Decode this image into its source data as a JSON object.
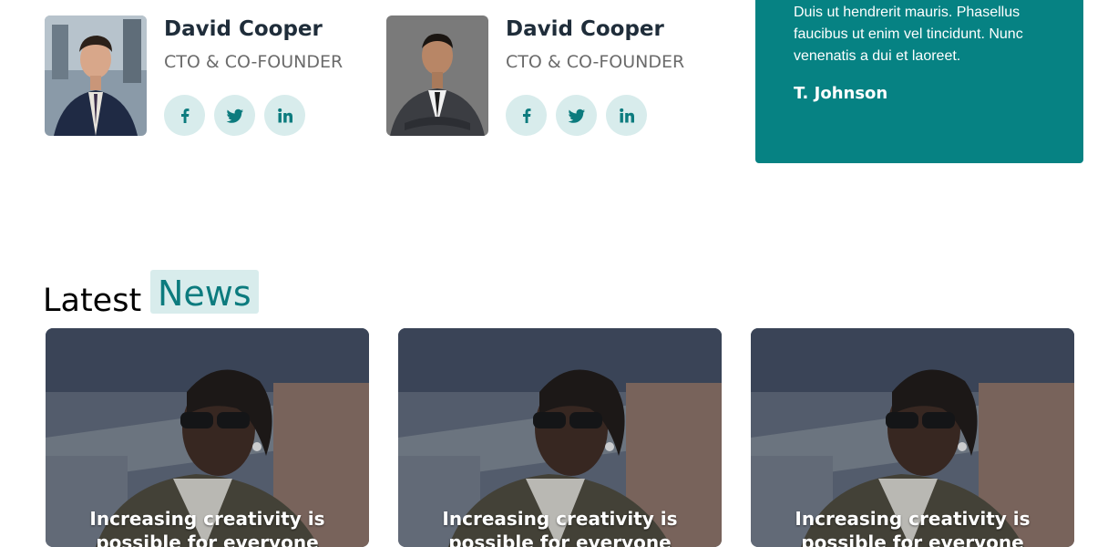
{
  "team": [
    {
      "name": "David Cooper",
      "role": "CTO & CO-FOUNDER",
      "photo_icon": "man-in-suit-portrait",
      "socials": [
        {
          "label": "f",
          "icon": "facebook-icon"
        },
        {
          "label": "twitter",
          "icon": "twitter-icon"
        },
        {
          "label": "in",
          "icon": "linkedin-icon"
        }
      ]
    },
    {
      "name": "David Cooper",
      "role": "CTO & CO-FOUNDER",
      "photo_icon": "man-in-suit-portrait",
      "socials": [
        {
          "label": "f",
          "icon": "facebook-icon"
        },
        {
          "label": "twitter",
          "icon": "twitter-icon"
        },
        {
          "label": "in",
          "icon": "linkedin-icon"
        }
      ]
    }
  ],
  "testimonial": {
    "text": "Duis ut hendrerit mauris. Phasellus faucibus ut enim vel tincidunt. Nunc venenatis a dui et laoreet.",
    "author": "T. Johnson"
  },
  "news_section": {
    "title_word1": "Latest",
    "title_word2": "News"
  },
  "news": [
    {
      "headline": "Increasing creativity is possible for everyone",
      "image": "man-with-sunglasses-photo"
    },
    {
      "headline": "Increasing creativity is possible for everyone",
      "image": "man-with-sunglasses-photo"
    },
    {
      "headline": "Increasing creativity is possible for everyone",
      "image": "man-with-sunglasses-photo"
    }
  ],
  "colors": {
    "accent": "#068283",
    "accent_light": "#d8ecec",
    "heading": "#1f2d3a",
    "muted": "#6b6b6b"
  }
}
